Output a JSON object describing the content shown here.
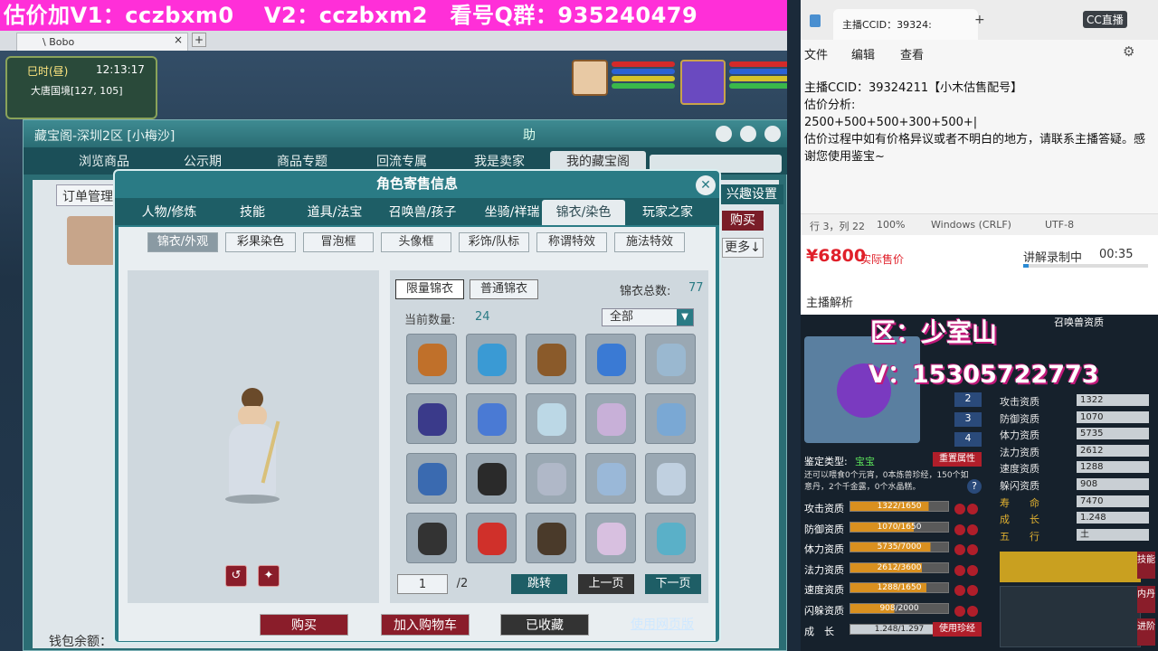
{
  "banner": "估价加V1：cczbxm0　 V2：cczbxm2　看号Q群：935240479",
  "browser": {
    "tab_title": "\\ Bobo",
    "close": "×",
    "new_tab": "+"
  },
  "hud": {
    "time_label": "巳时(昼)",
    "clock": "12:13:17",
    "location": "大唐国境[127, 105]"
  },
  "cbg": {
    "title": "藏宝阁-深圳2区 [小梅沙]",
    "title_icons": [
      "助"
    ],
    "tabs": [
      "浏览商品",
      "公示期",
      "商品专题",
      "回流专属",
      "我是卖家",
      "我的藏宝阁"
    ],
    "order_btn": "订单管理",
    "interest_btn": "兴趣设置",
    "buy_side_btn": "购买",
    "more_btn": "更多↓",
    "wallet": "钱包余额："
  },
  "dialog": {
    "title": "角色寄售信息",
    "close": "✕",
    "tabs": [
      "人物/修炼",
      "技能",
      "道具/法宝",
      "召唤兽/孩子",
      "坐骑/祥瑞",
      "锦衣/染色",
      "玩家之家"
    ],
    "subtabs": [
      "锦衣/外观",
      "彩果染色",
      "冒泡框",
      "头像框",
      "彩饰/队标",
      "称谓特效",
      "施法特效"
    ],
    "grid_buttons": [
      "限量锦衣",
      "普通锦衣"
    ],
    "total_label": "锦衣总数:",
    "total_value": "77",
    "current_label": "当前数量:",
    "current_value": "24",
    "filter": "全部",
    "page_current": "1",
    "page_total": "/2",
    "jump": "跳转",
    "prev": "上一页",
    "next": "下一页",
    "buy": "购买",
    "add_cart": "加入购物车",
    "collected": "已收藏",
    "web_link": "使用网页版"
  },
  "notepad": {
    "tab": "主播CCID：39324:",
    "menu": [
      "文件",
      "编辑",
      "查看"
    ],
    "lines": [
      "主播CCID：39324211【小木估售配号】",
      "估价分析:",
      "2500+500+500+300+500+|",
      "估价过程中如有价格异议或者不明白的地方，请联系主播答疑。感谢您使用鉴宝~"
    ],
    "status": [
      "行 3，列 22",
      "100%",
      "Windows (CRLF)",
      "UTF-8"
    ]
  },
  "cc_logo": "CC直播",
  "price": {
    "value": "¥6800",
    "note": "实际售价",
    "recording": "讲解录制中",
    "time": "00:35",
    "analysis": "主播解析"
  },
  "overlay": {
    "zone": "区：少室山",
    "v": "V：15305722773"
  },
  "pet": {
    "title": "召唤兽资质",
    "type_label": "鉴定类型:",
    "type_value": "宝宝",
    "reset_btn": "重置属性",
    "note": "还可以喂食0个元宵，0本炼兽珍经，150个如意丹，2个千金露，0个水晶糕。",
    "levels": [
      "2",
      "3",
      "4"
    ],
    "stats": [
      {
        "label": "攻击资质",
        "value": "1322"
      },
      {
        "label": "防御资质",
        "value": "1070"
      },
      {
        "label": "体力资质",
        "value": "5735"
      },
      {
        "label": "法力资质",
        "value": "2612"
      },
      {
        "label": "速度资质",
        "value": "1288"
      },
      {
        "label": "躲闪资质",
        "value": "908"
      },
      {
        "label": "寿　　命",
        "value": "7470"
      },
      {
        "label": "成　　长",
        "value": "1.248"
      },
      {
        "label": "五　　行",
        "value": "土"
      }
    ],
    "bars": [
      {
        "label": "攻击资质",
        "text": "1322/1650",
        "fill": 0.8
      },
      {
        "label": "防御资质",
        "text": "1070/1650",
        "fill": 0.65
      },
      {
        "label": "体力资质",
        "text": "5735/7000",
        "fill": 0.82
      },
      {
        "label": "法力资质",
        "text": "2612/3600",
        "fill": 0.73
      },
      {
        "label": "速度资质",
        "text": "1288/1650",
        "fill": 0.78
      },
      {
        "label": "闪躲资质",
        "text": "908/2000",
        "fill": 0.45
      }
    ],
    "growth_label": "成　长",
    "growth_text": "1.248/1.297",
    "use_btn": "使用珍经",
    "side_tabs": [
      "技能",
      "内丹",
      "进阶"
    ]
  }
}
